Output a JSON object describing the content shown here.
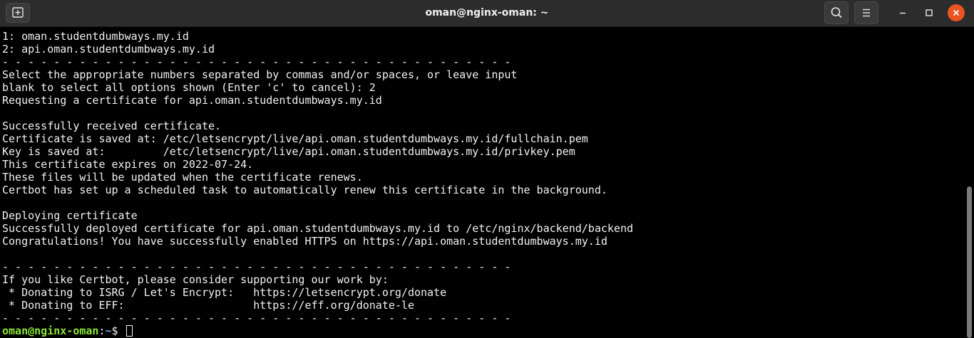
{
  "window": {
    "title": "oman@nginx-oman: ~"
  },
  "icons": {
    "new_tab": "new-tab-icon",
    "search": "search-icon",
    "menu": "hamburger-menu-icon",
    "minimize": "minimize-icon",
    "maximize": "maximize-icon",
    "close": "close-icon"
  },
  "colors": {
    "close_button": "#e95420",
    "prompt_user": "#8ae234",
    "prompt_path": "#729fcf"
  },
  "terminal": {
    "lines": [
      "1: oman.studentdumbways.my.id",
      "2: api.oman.studentdumbways.my.id",
      "- - - - - - - - - - - - - - - - - - - - - - - - - - - - - - - - - - - - - - - -",
      "Select the appropriate numbers separated by commas and/or spaces, or leave input",
      "blank to select all options shown (Enter 'c' to cancel): 2",
      "Requesting a certificate for api.oman.studentdumbways.my.id",
      "",
      "Successfully received certificate.",
      "Certificate is saved at: /etc/letsencrypt/live/api.oman.studentdumbways.my.id/fullchain.pem",
      "Key is saved at:         /etc/letsencrypt/live/api.oman.studentdumbways.my.id/privkey.pem",
      "This certificate expires on 2022-07-24.",
      "These files will be updated when the certificate renews.",
      "Certbot has set up a scheduled task to automatically renew this certificate in the background.",
      "",
      "Deploying certificate",
      "Successfully deployed certificate for api.oman.studentdumbways.my.id to /etc/nginx/backend/backend",
      "Congratulations! You have successfully enabled HTTPS on https://api.oman.studentdumbways.my.id",
      "",
      "- - - - - - - - - - - - - - - - - - - - - - - - - - - - - - - - - - - - - - - -",
      "If you like Certbot, please consider supporting our work by:",
      " * Donating to ISRG / Let's Encrypt:   https://letsencrypt.org/donate",
      " * Donating to EFF:                    https://eff.org/donate-le",
      "- - - - - - - - - - - - - - - - - - - - - - - - - - - - - - - - - - - - - - - -"
    ],
    "prompt": {
      "user_host": "oman@nginx-oman",
      "separator": ":",
      "path": "~",
      "symbol": "$ "
    }
  }
}
